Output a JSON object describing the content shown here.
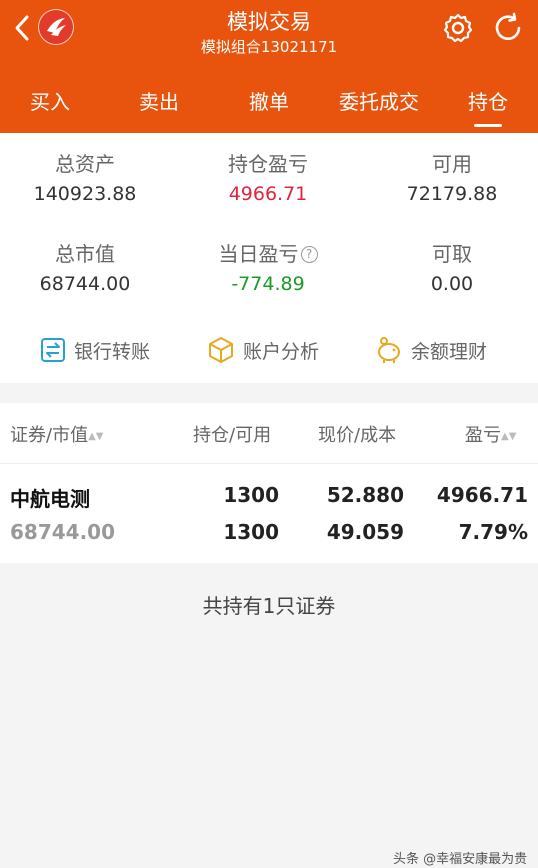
{
  "header": {
    "title": "模拟交易",
    "subtitle": "模拟组合13021171",
    "accent_color": "#e8540e"
  },
  "tabs": [
    {
      "label": "买入",
      "active": false
    },
    {
      "label": "卖出",
      "active": false
    },
    {
      "label": "撤单",
      "active": false
    },
    {
      "label": "委托成交",
      "active": false
    },
    {
      "label": "持仓",
      "active": true
    }
  ],
  "summary": {
    "total_assets_label": "总资产",
    "total_assets_value": "140923.88",
    "position_pl_label": "持仓盈亏",
    "position_pl_value": "4966.71",
    "available_label": "可用",
    "available_value": "72179.88",
    "market_value_label": "总市值",
    "market_value_value": "68744.00",
    "daily_pl_label": "当日盈亏",
    "daily_pl_value": "-774.89",
    "withdrawable_label": "可取",
    "withdrawable_value": "0.00"
  },
  "services": [
    {
      "label": "银行转账",
      "icon": "bank-transfer-icon"
    },
    {
      "label": "账户分析",
      "icon": "box-icon"
    },
    {
      "label": "余额理财",
      "icon": "piggy-bank-icon"
    }
  ],
  "table": {
    "headers": {
      "security": "证券/市值",
      "position": "持仓/可用",
      "price": "现价/成本",
      "pl": "盈亏"
    },
    "rows": [
      {
        "name": "中航电测",
        "market_value": "68744.00",
        "position": "1300",
        "available": "1300",
        "current_price": "52.880",
        "cost": "49.059",
        "pl": "4966.71",
        "pl_pct": "7.79%"
      }
    ]
  },
  "footer_note": "共持有1只证券",
  "watermark": "头条 @幸福安康最为贵"
}
